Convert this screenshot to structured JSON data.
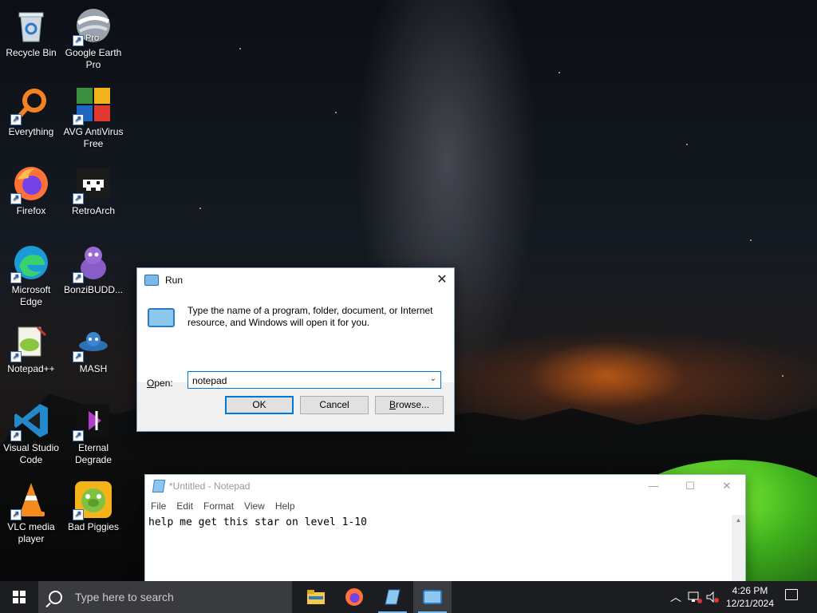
{
  "desktop": {
    "icons": [
      {
        "label": "Recycle Bin",
        "icon": "recycle-bin-icon"
      },
      {
        "label": "Google Earth Pro",
        "icon": "google-earth-icon"
      },
      {
        "label": "Everything",
        "icon": "everything-icon"
      },
      {
        "label": "AVG AntiVirus Free",
        "icon": "avg-antivirus-icon"
      },
      {
        "label": "Firefox",
        "icon": "firefox-icon"
      },
      {
        "label": "RetroArch",
        "icon": "retroarch-icon"
      },
      {
        "label": "Microsoft Edge",
        "icon": "edge-icon"
      },
      {
        "label": "BonziBUDD...",
        "icon": "bonzibuddy-icon"
      },
      {
        "label": "Notepad++",
        "icon": "notepadplusplus-icon"
      },
      {
        "label": "MASH",
        "icon": "mash-icon"
      },
      {
        "label": "Visual Studio Code",
        "icon": "vscode-icon"
      },
      {
        "label": "Eternal Degrade",
        "icon": "eternal-degrade-icon"
      },
      {
        "label": "VLC media player",
        "icon": "vlc-icon"
      },
      {
        "label": "Bad Piggies",
        "icon": "bad-piggies-icon"
      }
    ],
    "google_earth_badge": "Pro"
  },
  "run_dialog": {
    "title": "Run",
    "description": "Type the name of a program, folder, document, or Internet resource, and Windows will open it for you.",
    "open_label_underlined": "O",
    "open_label_rest": "pen:",
    "open_value": "notepad",
    "ok_label": "OK",
    "cancel_label": "Cancel",
    "browse_label_underlined": "B",
    "browse_label_rest": "rowse..."
  },
  "notepad": {
    "title": "*Untitled - Notepad",
    "menu": [
      "File",
      "Edit",
      "Format",
      "View",
      "Help"
    ],
    "content": "help me get this star on level 1-10"
  },
  "taskbar": {
    "search_placeholder": "Type here to search",
    "time": "4:26 PM",
    "date": "12/21/2024",
    "apps": [
      "file-explorer-icon",
      "firefox-icon",
      "notepad-icon",
      "run-icon"
    ]
  },
  "colors": {
    "accent": "#0078d7",
    "taskbar": "#1b1d21"
  }
}
